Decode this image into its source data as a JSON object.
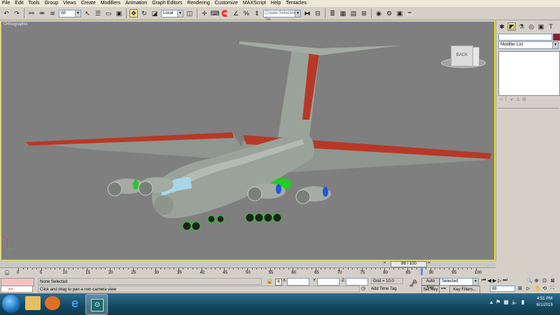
{
  "menu": [
    "File",
    "Edit",
    "Tools",
    "Group",
    "Views",
    "Create",
    "Modifiers",
    "Animation",
    "Graph Editors",
    "Rendering",
    "Customize",
    "MAXScript",
    "Help",
    "Tentacles"
  ],
  "toolbar": {
    "selection_filter": "All",
    "ref_coord": "Local",
    "named_selection": "Create Selection Se"
  },
  "viewport": {
    "label": "Orthographic",
    "viewcube_label": "BACK",
    "axis_x": "x",
    "axis_z": "z"
  },
  "command_panel": {
    "modifier_list": "Modifier List"
  },
  "timeline": {
    "frame_indicator": "88 / 100",
    "ticks": [
      "0",
      "5",
      "10",
      "15",
      "20",
      "25",
      "30",
      "35",
      "40",
      "45",
      "50",
      "55",
      "60",
      "65",
      "70",
      "75",
      "80",
      "85",
      "90",
      "95",
      "100"
    ],
    "current_fraction": 0.88
  },
  "status": {
    "selection": "None Selected",
    "prompt": "Click and drag to pan a non-camera view",
    "x_label": "X:",
    "y_label": "Y:",
    "z_label": "Z:",
    "grid": "Grid = 10.0",
    "add_time_tag": "Add Time Tag",
    "auto_key": "Auto Key",
    "set_key": "Set Key",
    "selected_option": "Selected",
    "key_filters": "Key Filters...",
    "frame": "88",
    "mini_listener": "<<"
  },
  "taskbar": {
    "time": "4:51 PM",
    "date": "6/1/2015"
  },
  "colors": {
    "viewport_bg": "#7f7f7f",
    "active_border": "#f0e000",
    "fuselage": "#9aa39a",
    "wing_red": "#b83828",
    "engine_green": "#22cc22",
    "engine_blue": "#2255dd"
  }
}
